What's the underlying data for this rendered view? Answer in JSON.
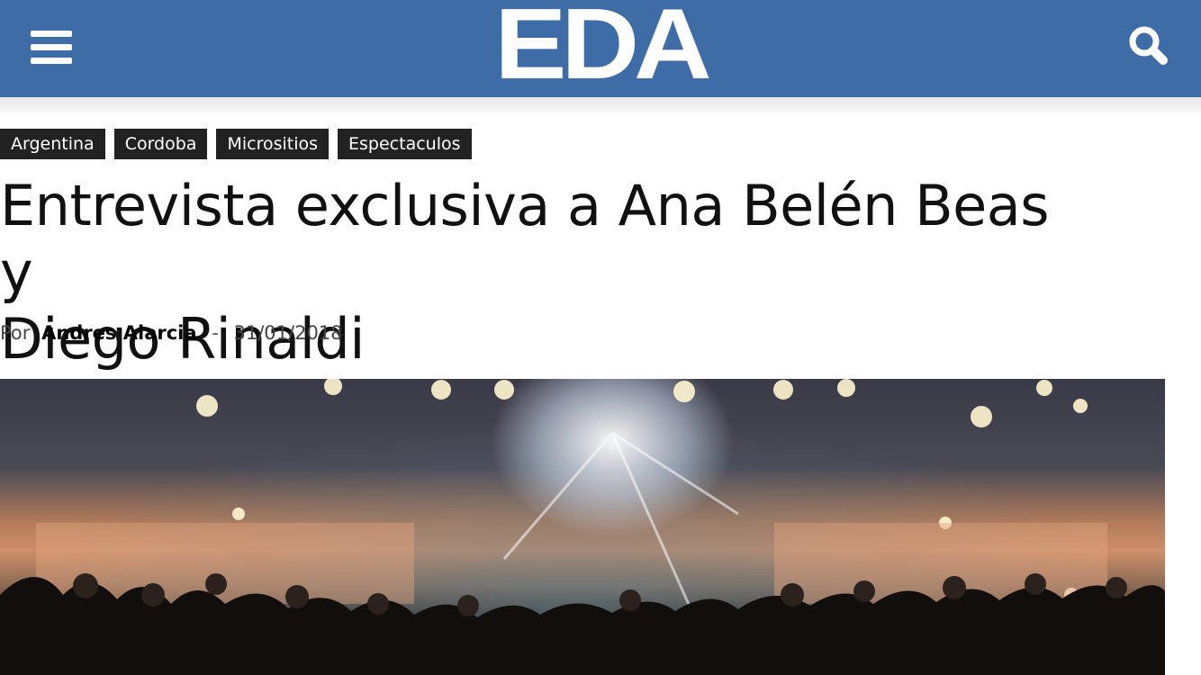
{
  "header": {
    "logo_text": "EDA",
    "menu_icon": "hamburger-menu-icon",
    "search_icon": "search-icon",
    "background_color": "#3d6ca6"
  },
  "tags": [
    "Argentina",
    "Cordoba",
    "Micrositios",
    "Espectaculos"
  ],
  "article": {
    "title_line1": "Entrevista exclusiva a Ana Belén Beas y",
    "title_line2": "Diego Rinaldi",
    "by_label": "Por",
    "author": "Andres Alarcia",
    "separator": "-",
    "date": "31/01/2018"
  }
}
